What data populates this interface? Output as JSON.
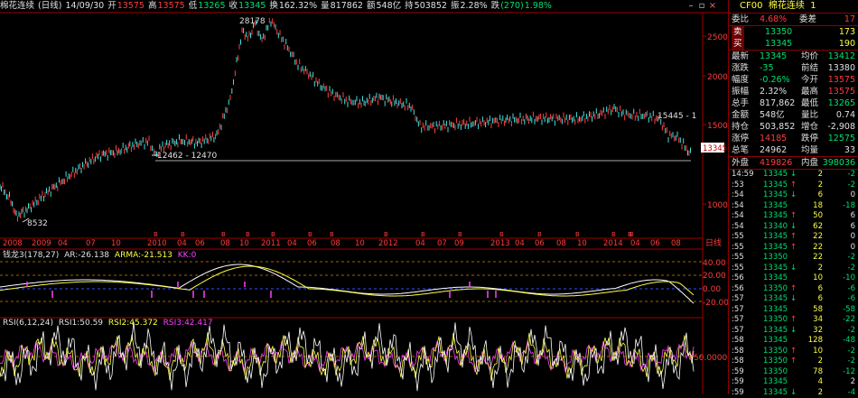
{
  "header": {
    "symbol": "棉花连续",
    "period": "(日线)",
    "date": "14/09/30",
    "open_label": "开",
    "open": "13575",
    "high_label": "高",
    "high": "13575",
    "low_label": "低",
    "low": "13265",
    "close_label": "收",
    "close": "13345",
    "turnover_label": "换",
    "turnover": "162.32%",
    "volume_label": "量",
    "volume": "817862",
    "amount_label": "额",
    "amount": "548亿",
    "oi_label": "持",
    "oi": "503852",
    "amplitude_label": "振",
    "amplitude": "2.28%",
    "change_label": "跌",
    "change": "(270)",
    "change_pct": "1.98%"
  },
  "window_controls": {
    "minimize": "–",
    "restore": "▫",
    "close": "×"
  },
  "main_chart": {
    "y_ticks": [
      "25000",
      "20000",
      "15000",
      "10000"
    ],
    "x_labels": [
      "2008",
      "2009",
      "04",
      "07",
      "10",
      "2010",
      "04",
      "06",
      "08",
      "10",
      "2011",
      "04",
      "06",
      "08",
      "10",
      "2012",
      "04",
      "07",
      "09",
      "2013",
      "04",
      "06",
      "08",
      "10",
      "2014",
      "04",
      "06",
      "08"
    ],
    "x_corner_label": "日线",
    "annotations": {
      "max": "28178",
      "min": "8532",
      "support": "12462 - 12470",
      "right_mark": "15445 - 1",
      "last_price": "13345"
    }
  },
  "macd_panel": {
    "title": "钱龙3(178,27)",
    "ar_label": "AR:",
    "ar": "-26.138",
    "arma_label": "ARMA:",
    "arma": "-21.513",
    "kk_label": "KK:",
    "kk": "0",
    "y_ticks": [
      "40.00",
      "20.00",
      "0.00",
      "-20.00"
    ],
    "colors": {
      "ar": "#ffffff",
      "arma": "#ffff40",
      "kk": "#ff40ff"
    }
  },
  "rsi_panel": {
    "title": "RSI(6,12,24)",
    "rsi1_label": "RSI1:",
    "rsi1": "50.59",
    "rsi2_label": "RSI2:",
    "rsi2": "45.372",
    "rsi3_label": "RSI3:",
    "rsi3": "42.417",
    "y_ticks": [
      "50.000000"
    ],
    "colors": {
      "rsi1": "#ffffff",
      "rsi2": "#ffff40",
      "rsi3": "#ff40ff"
    }
  },
  "quote_panel": {
    "code": "CF00",
    "name": "棉花连续",
    "name_suffix": "1",
    "weibi_label": "委比",
    "weibi": "4.68%",
    "weicha_label": "委差",
    "weicha": "17",
    "sell_label": "卖",
    "sell_price": "13350",
    "sell_vol": "173",
    "buy_label": "买",
    "buy_price": "13345",
    "buy_vol": "190",
    "rows": [
      {
        "l1": "最新",
        "v1": "13345",
        "c1": "g",
        "l2": "均价",
        "v2": "13412",
        "c2": "g"
      },
      {
        "l1": "涨跌",
        "v1": "-35",
        "c1": "g",
        "l2": "前结",
        "v2": "13380",
        "c2": "w"
      },
      {
        "l1": "幅度",
        "v1": "-0.26%",
        "c1": "g",
        "l2": "今开",
        "v2": "13575",
        "c2": "r"
      },
      {
        "l1": "振幅",
        "v1": "2.32%",
        "c1": "w",
        "l2": "最高",
        "v2": "13575",
        "c2": "r"
      },
      {
        "l1": "总手",
        "v1": "817,862",
        "c1": "w",
        "l2": "最低",
        "v2": "13265",
        "c2": "g"
      },
      {
        "l1": "金额",
        "v1": "548亿",
        "c1": "w",
        "l2": "量比",
        "v2": "0.74",
        "c2": "w"
      },
      {
        "l1": "持仓",
        "v1": "503,852",
        "c1": "w",
        "l2": "增仓",
        "v2": "-2,908",
        "c2": "w"
      },
      {
        "l1": "涨停",
        "v1": "14185",
        "c1": "r",
        "l2": "跌停",
        "v2": "12575",
        "c2": "g"
      },
      {
        "l1": "总笔",
        "v1": "24962",
        "c1": "w",
        "l2": "均量",
        "v2": "33",
        "c2": "w"
      }
    ],
    "outer_label": "外盘",
    "outer": "419826",
    "inner_label": "内盘",
    "inner": "398036"
  },
  "ticks": [
    {
      "t": "14:59",
      "p": "13345",
      "d": "↓",
      "v": "2",
      "o": "-2",
      "pc": "g",
      "dc": "g",
      "oc": "g"
    },
    {
      "t": ":53",
      "p": "13345",
      "d": "↑",
      "v": "2",
      "o": "-2",
      "pc": "g",
      "dc": "r",
      "oc": "g"
    },
    {
      "t": ":54",
      "p": "13345",
      "d": "↓",
      "v": "6",
      "o": "0",
      "pc": "g",
      "dc": "g",
      "oc": "w"
    },
    {
      "t": ":54",
      "p": "13345",
      "d": "",
      "v": "18",
      "o": "-18",
      "pc": "g",
      "dc": "w",
      "oc": "g"
    },
    {
      "t": ":54",
      "p": "13345",
      "d": "↑",
      "v": "50",
      "o": "6",
      "pc": "g",
      "dc": "r",
      "oc": "w"
    },
    {
      "t": ":54",
      "p": "13340",
      "d": "↓",
      "v": "62",
      "o": "6",
      "pc": "g",
      "dc": "g",
      "oc": "w"
    },
    {
      "t": ":55",
      "p": "13345",
      "d": "↑",
      "v": "22",
      "o": "0",
      "pc": "g",
      "dc": "r",
      "oc": "w"
    },
    {
      "t": ":55",
      "p": "13345",
      "d": "↑",
      "v": "22",
      "o": "0",
      "pc": "g",
      "dc": "r",
      "oc": "w"
    },
    {
      "t": ":55",
      "p": "13350",
      "d": "",
      "v": "22",
      "o": "-2",
      "pc": "g",
      "dc": "w",
      "oc": "g"
    },
    {
      "t": ":55",
      "p": "13345",
      "d": "↓",
      "v": "2",
      "o": "-2",
      "pc": "g",
      "dc": "g",
      "oc": "g"
    },
    {
      "t": ":56",
      "p": "13345",
      "d": "",
      "v": "10",
      "o": "-10",
      "pc": "g",
      "dc": "w",
      "oc": "g"
    },
    {
      "t": ":56",
      "p": "13350",
      "d": "↑",
      "v": "6",
      "o": "-6",
      "pc": "g",
      "dc": "r",
      "oc": "g"
    },
    {
      "t": ":57",
      "p": "13345",
      "d": "↓",
      "v": "6",
      "o": "-6",
      "pc": "g",
      "dc": "g",
      "oc": "g"
    },
    {
      "t": ":57",
      "p": "13345",
      "d": "",
      "v": "58",
      "o": "-58",
      "pc": "g",
      "dc": "w",
      "oc": "g"
    },
    {
      "t": ":57",
      "p": "13350",
      "d": "↑",
      "v": "34",
      "o": "-22",
      "pc": "g",
      "dc": "r",
      "oc": "g"
    },
    {
      "t": ":57",
      "p": "13345",
      "d": "↓",
      "v": "32",
      "o": "-2",
      "pc": "g",
      "dc": "g",
      "oc": "g"
    },
    {
      "t": ":58",
      "p": "13345",
      "d": "",
      "v": "128",
      "o": "-48",
      "pc": "g",
      "dc": "w",
      "oc": "g"
    },
    {
      "t": ":58",
      "p": "13350",
      "d": "↑",
      "v": "10",
      "o": "-2",
      "pc": "g",
      "dc": "r",
      "oc": "g"
    },
    {
      "t": ":58",
      "p": "13350",
      "d": "↑",
      "v": "2",
      "o": "-2",
      "pc": "g",
      "dc": "r",
      "oc": "g"
    },
    {
      "t": ":59",
      "p": "13350",
      "d": "",
      "v": "78",
      "o": "-12",
      "pc": "g",
      "dc": "w",
      "oc": "g"
    },
    {
      "t": ":59",
      "p": "13345",
      "d": "",
      "v": "4",
      "o": "2",
      "pc": "g",
      "dc": "w",
      "oc": "w"
    },
    {
      "t": ":59",
      "p": "13345",
      "d": "↓",
      "v": "2",
      "o": "-4",
      "pc": "g",
      "dc": "g",
      "oc": "g"
    }
  ]
}
